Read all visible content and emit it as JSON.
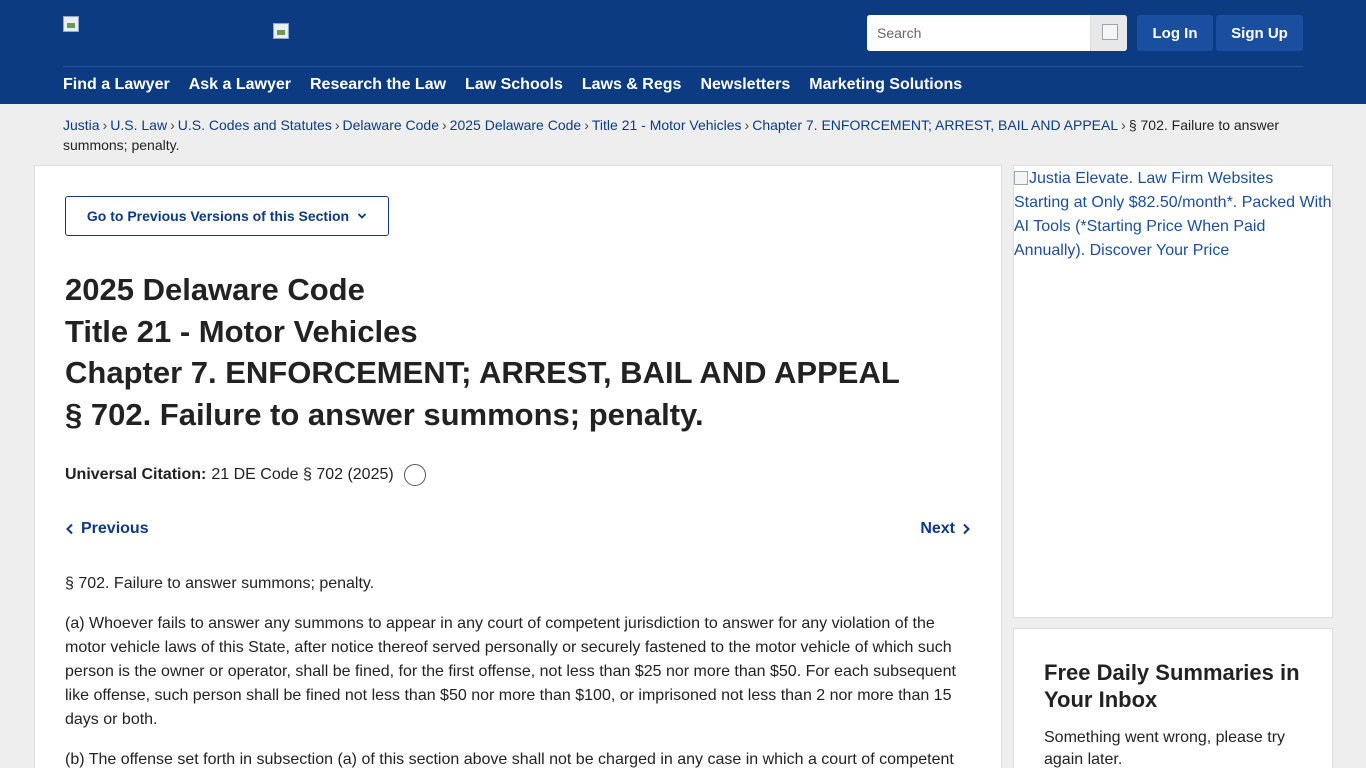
{
  "header": {
    "search_placeholder": "Search",
    "login_label": "Log In",
    "signup_label": "Sign Up",
    "nav": [
      "Find a Lawyer",
      "Ask a Lawyer",
      "Research the Law",
      "Law Schools",
      "Laws & Regs",
      "Newsletters",
      "Marketing Solutions"
    ]
  },
  "breadcrumb": {
    "items": [
      "Justia",
      "U.S. Law",
      "U.S. Codes and Statutes",
      "Delaware Code",
      "2025 Delaware Code",
      "Title 21 - Motor Vehicles",
      "Chapter 7. ENFORCEMENT; ARREST, BAIL AND APPEAL"
    ],
    "current": "§ 702. Failure to answer summons; penalty.",
    "separator": "›"
  },
  "main": {
    "versions_label": "Go to Previous Versions of this Section",
    "titles": [
      "2025 Delaware Code",
      "Title 21 - Motor Vehicles",
      "Chapter 7. ENFORCEMENT; ARREST, BAIL AND APPEAL",
      "§ 702. Failure to answer summons; penalty."
    ],
    "citation_label": "Universal Citation:",
    "citation_value": "21 DE Code § 702 (2025)",
    "previous_label": "Previous",
    "next_label": "Next",
    "paragraphs": [
      "§ 702. Failure to answer summons; penalty.",
      "(a) Whoever fails to answer any summons to appear in any court of competent jurisdiction to answer for any violation of the motor vehicle laws of this State, after notice thereof served personally or securely fastened to the motor vehicle of which such person is the owner or operator, shall be fined, for the first offense, not less than $25 nor more than $50. For each subsequent like offense, such person shall be fined not less than $50 nor more than $100, or imprisoned not less than 2 nor more than 15 days or both.",
      "(b) The offense set forth in subsection (a) of this section above shall not be charged in any case in which a court of competent"
    ]
  },
  "sidebar": {
    "ad_alt": "Justia Elevate. Law Firm Websites Starting at Only $82.50/month*. Packed With AI Tools (*Starting Price When Paid Annually). Discover Your Price",
    "newsletter_title": "Free Daily Summaries in Your Inbox",
    "newsletter_message": "Something went wrong, please try again later."
  },
  "colors": {
    "header_bg": "#0c3b82",
    "link": "#0c3b82",
    "button": "#1a4fa0"
  }
}
